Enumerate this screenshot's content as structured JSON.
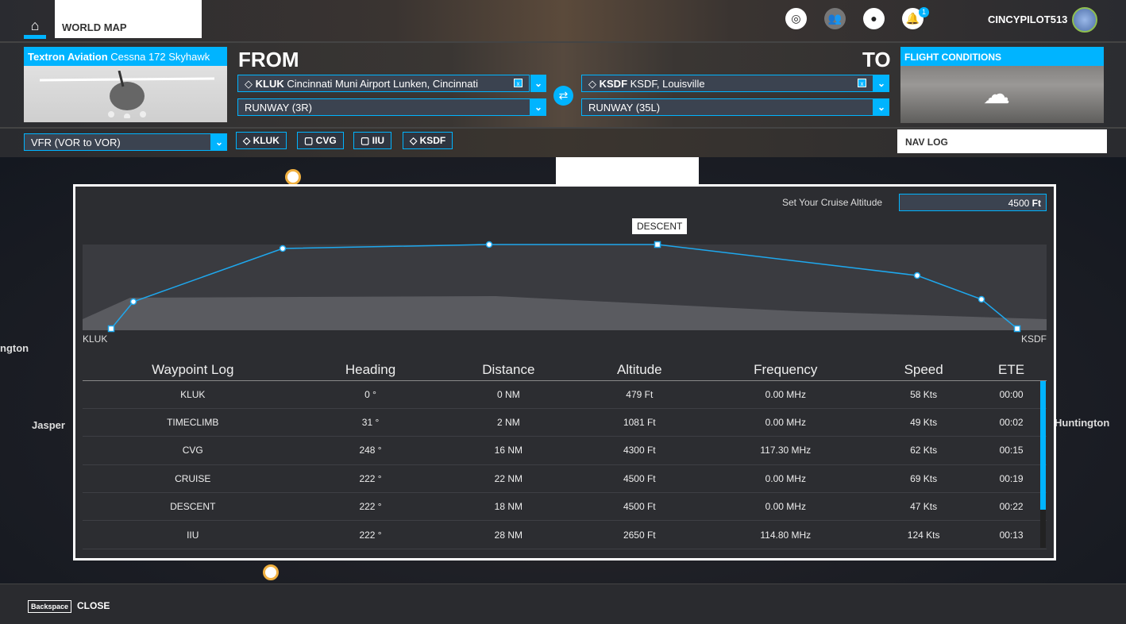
{
  "topbar": {
    "home_icon": "home-icon",
    "world_map_tab": "WORLD MAP",
    "icons": [
      "radar-icon",
      "friends-icon",
      "profile-icon",
      "notification-bell-icon"
    ],
    "notification_count": "1",
    "username": "CINCYPILOT513"
  },
  "aircraft": {
    "maker": "Textron Aviation",
    "model": "Cessna 172 Skyhawk"
  },
  "from": {
    "heading": "FROM",
    "icao": "KLUK",
    "name": "Cincinnati Muni Airport Lunken, Cincinnati",
    "runway": "RUNWAY (3R)"
  },
  "to": {
    "heading": "TO",
    "icao": "KSDF",
    "name": "KSDF, Louisville",
    "runway": "RUNWAY (35L)"
  },
  "flight_conditions": {
    "label": "FLIGHT CONDITIONS",
    "icon": "cloud-icon"
  },
  "flight_type": "VFR (VOR to VOR)",
  "waypoints": [
    {
      "label": "KLUK",
      "icon": "airport-icon"
    },
    {
      "label": "CVG",
      "icon": "vor-icon"
    },
    {
      "label": "IIU",
      "icon": "vor-icon"
    },
    {
      "label": "KSDF",
      "icon": "airport-icon"
    }
  ],
  "nav_log": "NAV LOG",
  "map_labels": [
    "ngton",
    "Jasper",
    "Huntington"
  ],
  "modal": {
    "cruise_label": "Set Your Cruise Altitude",
    "cruise_value": "4500",
    "cruise_unit": "Ft",
    "descent_tag": "DESCENT",
    "start_label": "KLUK",
    "end_label": "KSDF",
    "columns": [
      "Waypoint Log",
      "Heading",
      "Distance",
      "Altitude",
      "Frequency",
      "Speed",
      "ETE"
    ],
    "rows": [
      [
        "KLUK",
        "0 °",
        "0 NM",
        "479 Ft",
        "0.00 MHz",
        "58 Kts",
        "00:00"
      ],
      [
        "TIMECLIMB",
        "31 °",
        "2 NM",
        "1081 Ft",
        "0.00 MHz",
        "49 Kts",
        "00:02"
      ],
      [
        "CVG",
        "248 °",
        "16 NM",
        "4300 Ft",
        "117.30 MHz",
        "62 Kts",
        "00:15"
      ],
      [
        "CRUISE",
        "222 °",
        "22 NM",
        "4500 Ft",
        "0.00 MHz",
        "69 Kts",
        "00:19"
      ],
      [
        "DESCENT",
        "222 °",
        "18 NM",
        "4500 Ft",
        "0.00 MHz",
        "47 Kts",
        "00:22"
      ],
      [
        "IIU",
        "222 °",
        "28 NM",
        "2650 Ft",
        "114.80 MHz",
        "124 Kts",
        "00:13"
      ]
    ]
  },
  "footer": {
    "key": "Backspace",
    "close": "CLOSE"
  },
  "colors": {
    "accent": "#00b4ff"
  }
}
